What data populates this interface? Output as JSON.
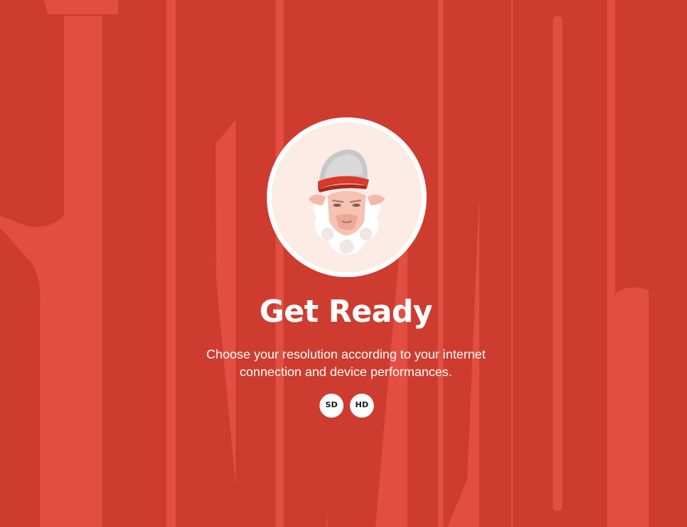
{
  "colors": {
    "background": "#e24f42",
    "letters": "#cd3c2f",
    "avatar_ring": "#ffffff",
    "avatar_fill": "#fdebe5",
    "text": "#ffffff"
  },
  "avatar": {
    "icon": "sheep-with-cap-icon"
  },
  "heading": {
    "title": "Get Ready",
    "description": "Choose your resolution according to your internet connection and device performances."
  },
  "resolution": {
    "options": [
      {
        "label": "SD"
      },
      {
        "label": "HD"
      }
    ]
  }
}
